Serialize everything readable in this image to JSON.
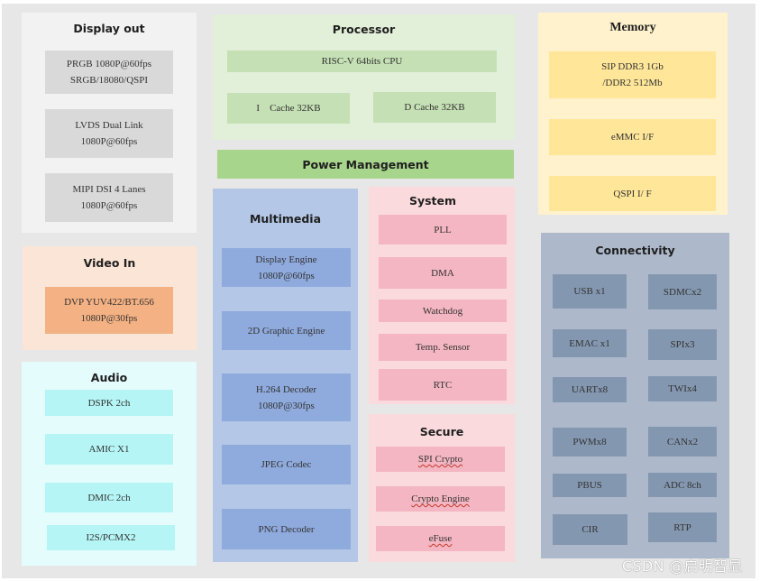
{
  "diagram": {
    "display_out": {
      "title": "Display out",
      "blocks": [
        {
          "line1": "PRGB 1080P@60fps",
          "line2": "SRGB/18080/QSPI"
        },
        {
          "line1": "LVDS Dual Link",
          "line2": "1080P@60fps"
        },
        {
          "line1": "MIPI DSI 4 Lanes",
          "line2": "1080P@60fps"
        }
      ]
    },
    "video_in": {
      "title": "Video In",
      "blocks": [
        {
          "line1": "DVP YUV422/BT.656",
          "line2": "1080P@30fps"
        }
      ]
    },
    "audio": {
      "title": "Audio",
      "blocks": [
        "DSPK 2ch",
        "AMIC X1",
        "DMIC 2ch",
        "I2S/PCMX2"
      ]
    },
    "processor": {
      "title": "Processor",
      "cpu": "RISC-V 64bits CPU",
      "icache": "I    Cache 32KB",
      "dcache": "D Cache 32KB"
    },
    "power_management": "Power Management",
    "multimedia": {
      "title": "Multimedia",
      "blocks": [
        {
          "line1": "Display Engine",
          "line2": "1080P@60fps"
        },
        {
          "line1": "2D Graphic Engine",
          "line2": ""
        },
        {
          "line1": "H.264 Decoder",
          "line2": "1080P@30fps"
        },
        {
          "line1": "JPEG Codec",
          "line2": ""
        },
        {
          "line1": "PNG Decoder",
          "line2": ""
        }
      ]
    },
    "system": {
      "title": "System",
      "blocks": [
        "PLL",
        "DMA",
        "Watchdog",
        "Temp. Sensor",
        "RTC"
      ]
    },
    "secure": {
      "title": "Secure",
      "blocks": [
        "SPI Crypto",
        "Crypto Engine",
        "eFuse"
      ]
    },
    "memory": {
      "title": "Memory",
      "blocks": [
        {
          "line1": "SIP DDR3 1Gb",
          "line2": "/DDR2 512Mb"
        },
        {
          "line1": "eMMC I/F",
          "line2": ""
        },
        {
          "line1": "QSPI I/ F",
          "line2": ""
        }
      ]
    },
    "connectivity": {
      "title": "Connectivity",
      "blocks": [
        "USB x1",
        "SDMCx2",
        "EMAC x1",
        "SPIx3",
        "UARTx8",
        "TWIx4",
        "PWMx8",
        "CANx2",
        "PBUS",
        "ADC 8ch",
        "CIR",
        "RTP"
      ]
    },
    "colors": {
      "display_out_group": "#f2f2f2",
      "display_out_block": "#d9d9d9",
      "video_in_group": "#fbe5d6",
      "video_in_block": "#f4b183",
      "audio_group": "#e5fcfc",
      "audio_block": "#b5f5f5",
      "processor_group": "#e2f0d9",
      "processor_block": "#c5e0b4",
      "power_management": "#a9d18e",
      "multimedia_group": "#b4c7e7",
      "multimedia_block": "#8faadc",
      "system_group": "#fadadd",
      "system_block": "#f4b6c2",
      "memory_group": "#fff2cc",
      "memory_block": "#ffe699",
      "connectivity_group": "#adb9ca",
      "connectivity_block": "#8497b0"
    }
  },
  "watermark": "CSDN @启明智显"
}
